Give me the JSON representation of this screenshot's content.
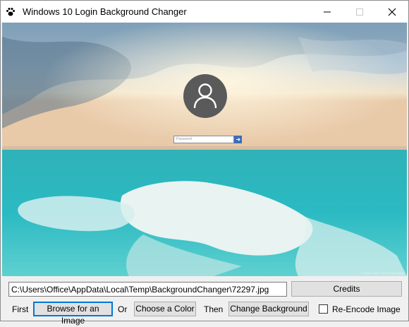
{
  "window": {
    "title": "Windows 10 Login Background Changer",
    "icon": "paw-icon",
    "controls": [
      "minimize-icon",
      "maximize-icon",
      "close-icon"
    ]
  },
  "preview": {
    "description_icon": "user-avatar-icon",
    "password_placeholder": "Password",
    "submit_icon": "arrow-right-icon",
    "credit_text": "© Ophiro Tolar / SA / Getty Images"
  },
  "controls": {
    "path_value": "C:\\Users\\Office\\AppData\\Local\\Temp\\BackgroundChanger\\72297.jpg",
    "credits_label": "Credits",
    "first_label": "First",
    "browse_label": "Browse for an Image",
    "or_label": "Or",
    "color_label": "Choose a Color",
    "then_label": "Then",
    "change_label": "Change Background",
    "reencode_label": "Re-Encode Image",
    "reencode_checked": false
  }
}
